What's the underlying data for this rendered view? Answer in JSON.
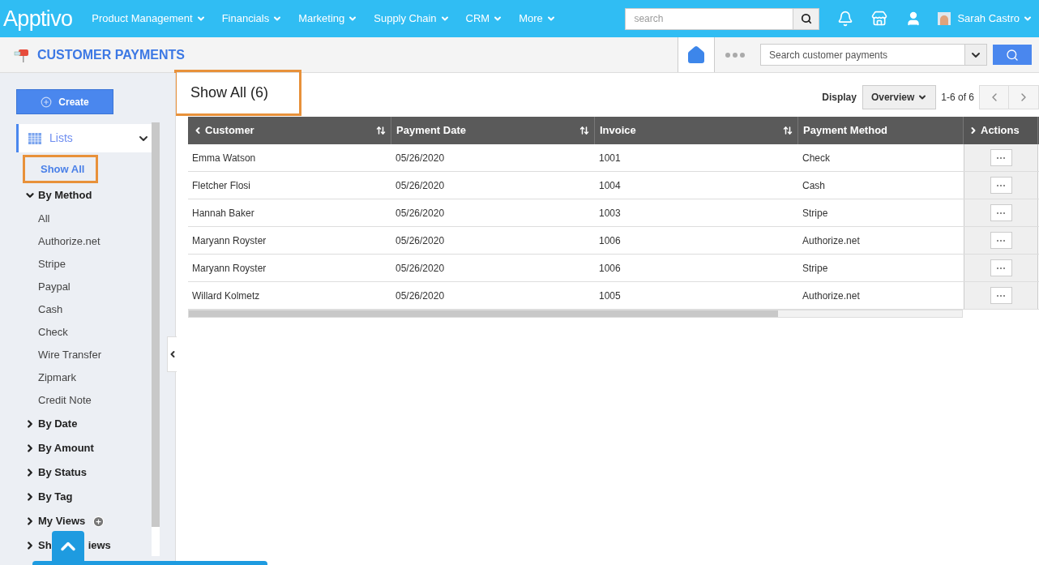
{
  "nav": {
    "logo": "Apptivo",
    "menus": [
      {
        "label": "Product Management"
      },
      {
        "label": "Financials"
      },
      {
        "label": "Marketing"
      },
      {
        "label": "Supply Chain"
      },
      {
        "label": "CRM"
      },
      {
        "label": "More"
      }
    ],
    "search": {
      "placeholder": "search"
    },
    "user": "Sarah Castro"
  },
  "header": {
    "title": "CUSTOMER PAYMENTS",
    "search": {
      "placeholder": "Search customer payments"
    }
  },
  "sidebar": {
    "create": "Create",
    "lists": {
      "label": "Lists",
      "expanded": true
    },
    "show_all": {
      "label": "Show All",
      "selected": true
    },
    "groups": [
      {
        "label": "By Method",
        "expanded": true,
        "children": [
          {
            "label": "All"
          },
          {
            "label": "Authorize.net"
          },
          {
            "label": "Stripe"
          },
          {
            "label": "Paypal"
          },
          {
            "label": "Cash"
          },
          {
            "label": "Check"
          },
          {
            "label": "Wire Transfer"
          },
          {
            "label": "Zipmark"
          },
          {
            "label": "Credit Note"
          }
        ]
      },
      {
        "label": "By Date",
        "expanded": false
      },
      {
        "label": "By Amount",
        "expanded": false
      },
      {
        "label": "By Status",
        "expanded": false
      },
      {
        "label": "By Tag",
        "expanded": false
      },
      {
        "label": "My Views",
        "expanded": false,
        "addable": true
      },
      {
        "label": "Sh",
        "label_end": "iews",
        "expanded": false
      }
    ]
  },
  "view": {
    "title": "Show All (6)",
    "display_label": "Display",
    "display": "Overview",
    "range": "1-6 of 6"
  },
  "table": {
    "columns": [
      {
        "label": "Customer",
        "sortable": true
      },
      {
        "label": "Payment Date",
        "sortable": true
      },
      {
        "label": "Invoice",
        "sortable": true
      },
      {
        "label": "Payment Method",
        "sortable": false
      },
      {
        "label": "Actions",
        "sortable": false
      }
    ],
    "rows": [
      [
        "Emma Watson",
        "05/26/2020",
        "1001",
        "Check"
      ],
      [
        "Fletcher Flosi",
        "05/26/2020",
        "1004",
        "Cash"
      ],
      [
        "Hannah Baker",
        "05/26/2020",
        "1003",
        "Stripe"
      ],
      [
        "Maryann Royster",
        "05/26/2020",
        "1006",
        "Authorize.net"
      ],
      [
        "Maryann Royster",
        "05/26/2020",
        "1006",
        "Stripe"
      ],
      [
        "Willard Kolmetz",
        "05/26/2020",
        "1005",
        "Authorize.net"
      ]
    ]
  }
}
